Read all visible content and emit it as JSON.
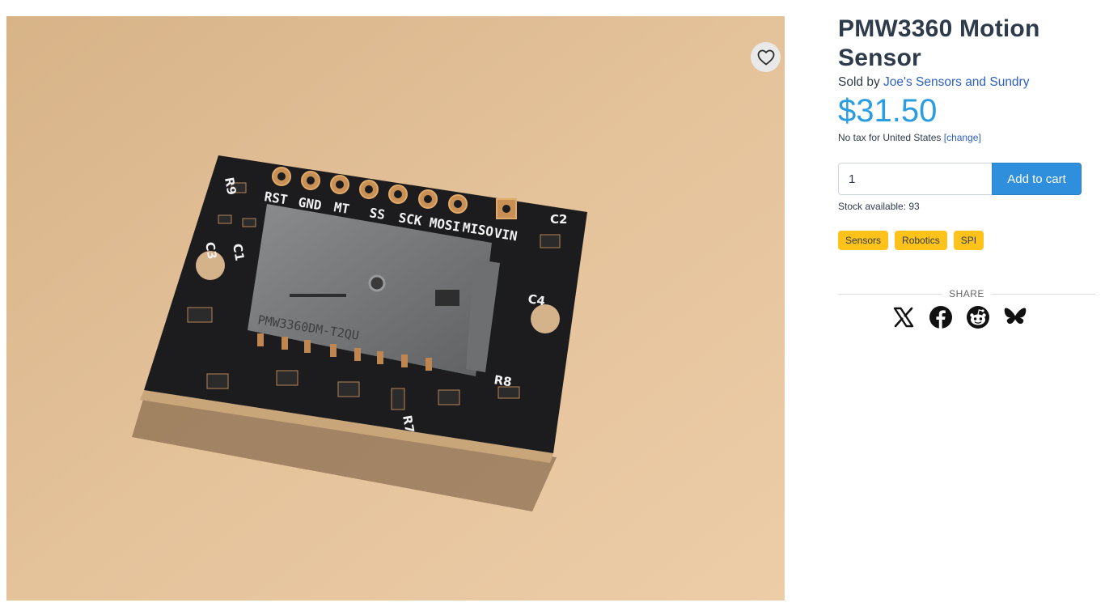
{
  "product": {
    "title": "PMW3360 Motion Sensor",
    "sold_by_prefix": "Sold by",
    "seller": "Joe's Sensors and Sundry",
    "price": "$31.50",
    "tax_note": "No tax for United States",
    "tax_change": "[change]",
    "quantity": "1",
    "add_to_cart": "Add to cart",
    "stock": "Stock available: 93",
    "tags": [
      "Sensors",
      "Robotics",
      "SPI"
    ]
  },
  "board_labels": {
    "pins": [
      "RST",
      "GND",
      "MT",
      "SS",
      "SCK",
      "MOSI",
      "MISO",
      "VIN"
    ],
    "chip": "PMW3360DM-T2QU",
    "refs": [
      "R9",
      "C3",
      "C1",
      "C2",
      "C4",
      "R8",
      "R7"
    ]
  },
  "share": {
    "label": "SHARE",
    "icons": [
      "x-icon",
      "facebook-icon",
      "reddit-icon",
      "bluesky-icon"
    ]
  },
  "colors": {
    "price": "#2a9ce0",
    "link": "#2d5fc4",
    "button": "#2f8fdc",
    "tag": "#ffc21a",
    "text": "#2e3b4b"
  }
}
